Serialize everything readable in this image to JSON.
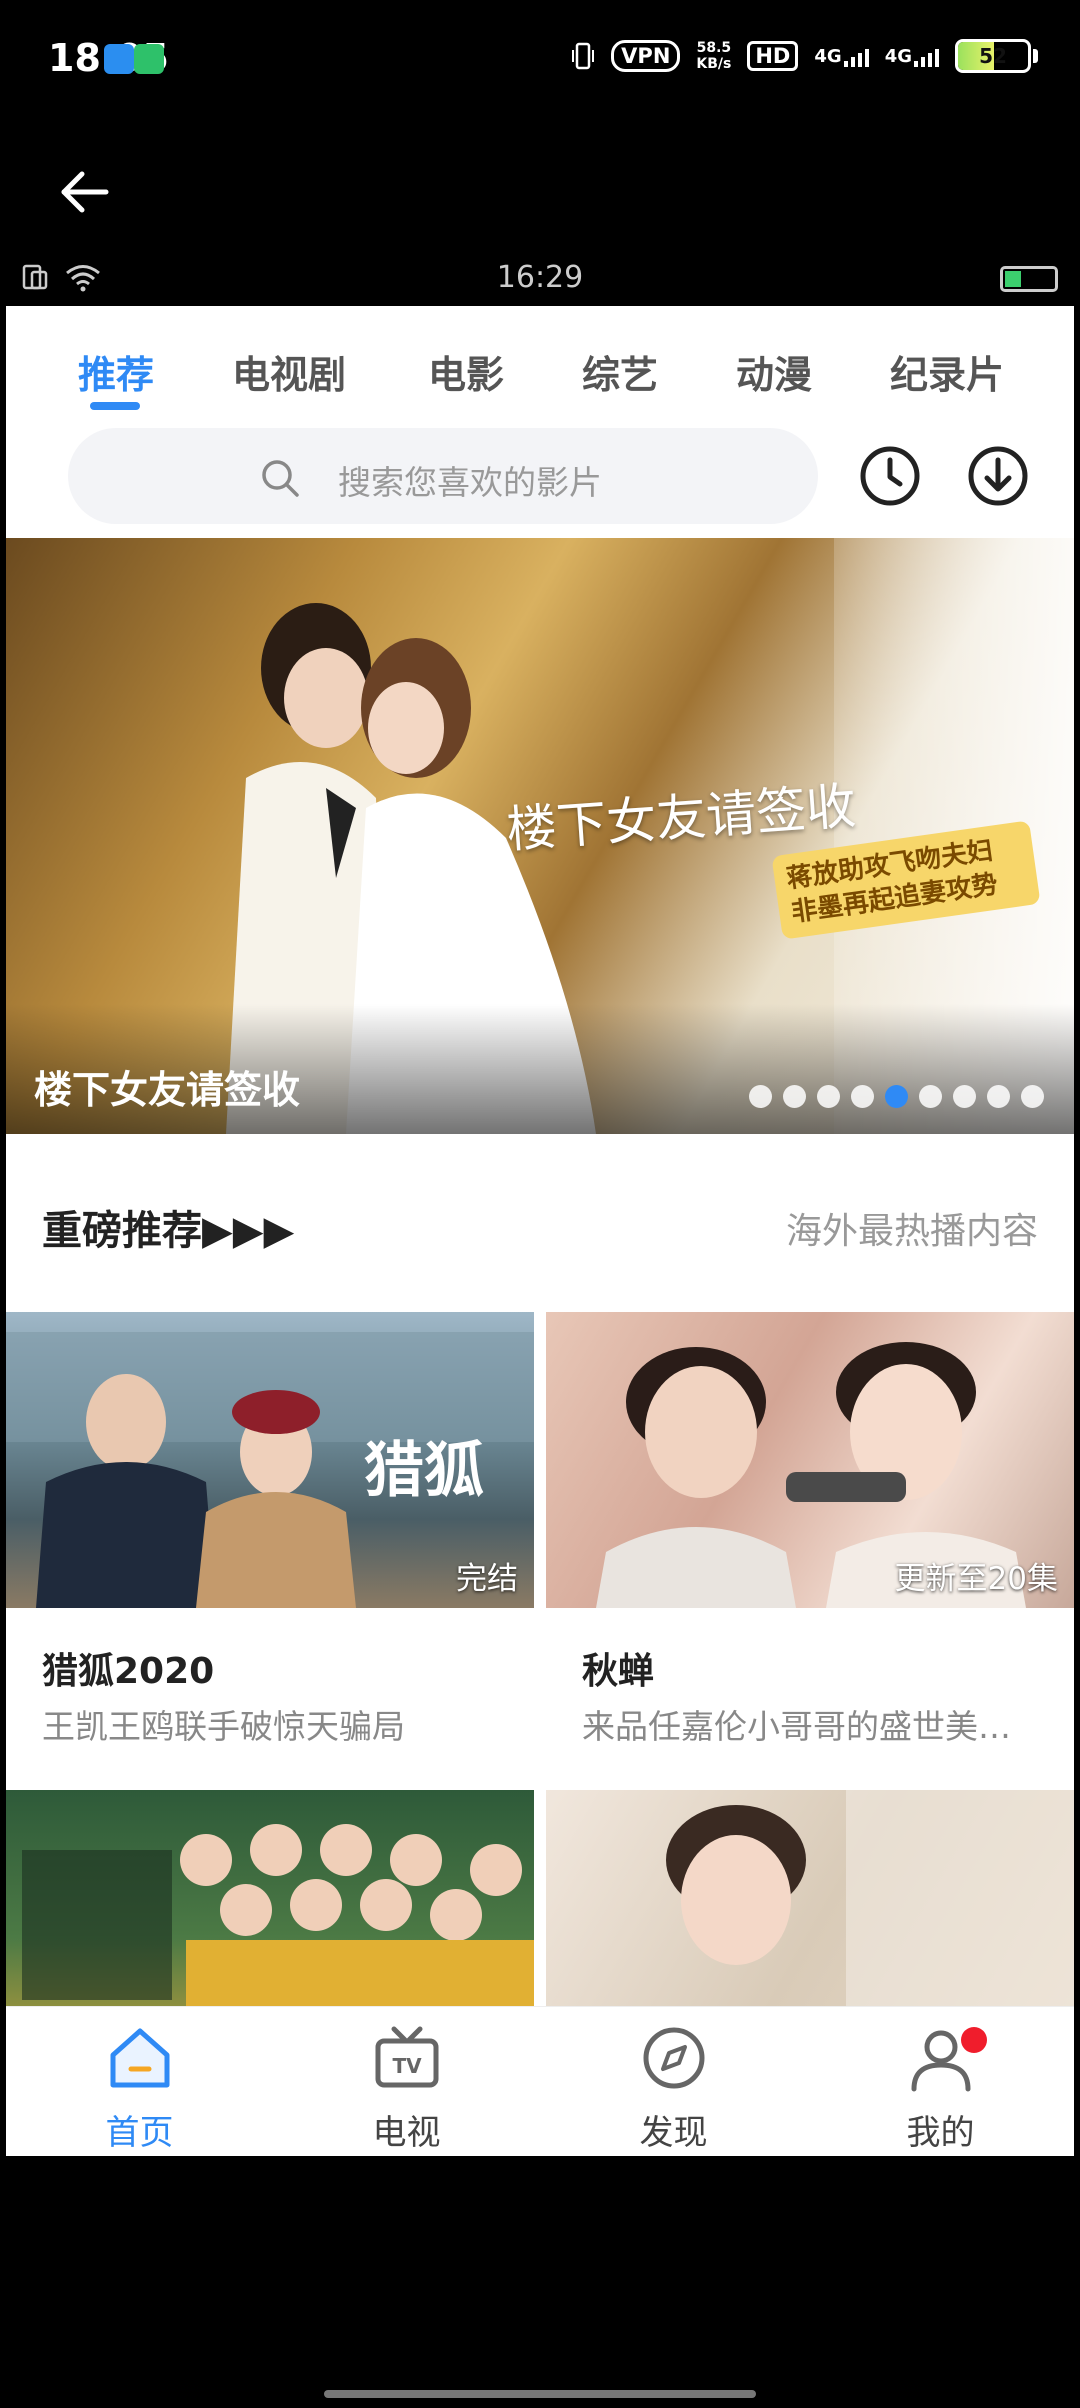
{
  "system_status": {
    "time": "18:05",
    "vpn": "VPN",
    "speed_value": "58.5",
    "speed_unit": "KB/s",
    "hd": "HD",
    "net1": "4G",
    "net2": "4G",
    "battery": "52"
  },
  "inner_status": {
    "time": "16:29"
  },
  "tabs": [
    "推荐",
    "电视剧",
    "电影",
    "综艺",
    "动漫",
    "纪录片"
  ],
  "active_tab": 0,
  "search": {
    "placeholder": "搜索您喜欢的影片"
  },
  "banner": {
    "caption": "楼下女友请签收",
    "overlay_title": "楼下女友请签收",
    "tagline": "蒋放助攻飞吻夫妇 非墨再起追妻攻势",
    "dot_count": 9,
    "active_dot": 4
  },
  "section": {
    "title": "重磅推荐▶▶▶",
    "subtitle": "海外最热播内容"
  },
  "cards": [
    {
      "title": "猎狐2020",
      "desc": "王凯王鸥联手破惊天骗局",
      "badge": "完结",
      "thumb_text": "猎狐"
    },
    {
      "title": "秋蝉",
      "desc": "来品任嘉伦小哥哥的盛世美…",
      "badge": "更新至20集",
      "thumb_text": ""
    },
    {
      "title": "",
      "desc": "",
      "badge": "",
      "thumb_text": ""
    },
    {
      "title": "",
      "desc": "",
      "badge": "",
      "thumb_text": ""
    }
  ],
  "bottom_nav": [
    {
      "label": "首页",
      "icon": "home-icon"
    },
    {
      "label": "电视",
      "icon": "tv-icon"
    },
    {
      "label": "发现",
      "icon": "compass-icon"
    },
    {
      "label": "我的",
      "icon": "user-icon"
    }
  ],
  "colors": {
    "accent": "#2f8af5",
    "notification": "#f01d2c"
  }
}
